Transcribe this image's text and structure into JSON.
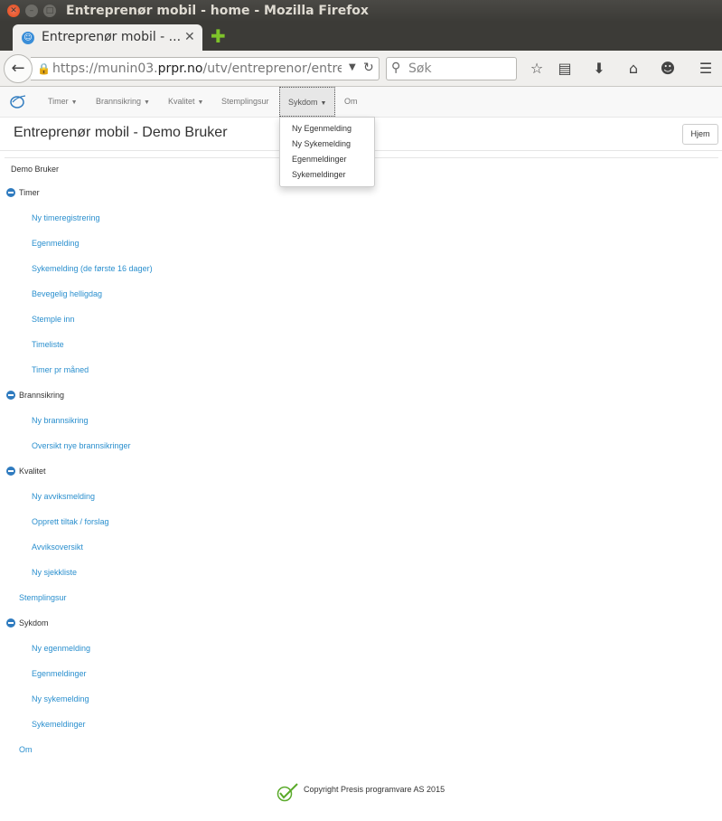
{
  "window": {
    "title": "Entreprenør mobil - home - Mozilla Firefox",
    "close_glyph": "✕",
    "min_glyph": "–",
    "max_glyph": "□"
  },
  "browser": {
    "tab_title": "Entreprenør mobil - ...",
    "tab_close": "✕",
    "new_tab": "✚",
    "url_prefix": "https://munin03.",
    "url_domain": "prpr.no",
    "url_suffix": "/utv/entreprenor/entrep",
    "search_placeholder": "Søk",
    "icons": [
      "bookmark-star-icon",
      "reading-list-icon",
      "download-icon",
      "home-icon",
      "smiley-icon",
      "menu-icon"
    ]
  },
  "nav": {
    "items": [
      "Timer",
      "Brannsikring",
      "Kvalitet",
      "Stemplingsur",
      "Sykdom",
      "Om"
    ],
    "active": "Sykdom"
  },
  "dropdown": [
    "Ny Egenmelding",
    "Ny Sykemelding",
    "Egenmeldinger",
    "Sykemeldinger"
  ],
  "page": {
    "title": "Entreprenør mobil - Demo Bruker",
    "home_button": "Hjem",
    "user": "Demo Bruker"
  },
  "menu": {
    "timer": {
      "label": "Timer",
      "items": [
        "Ny timeregistrering",
        "Egenmelding",
        "Sykemelding (de første 16 dager)",
        "Bevegelig helligdag",
        "Stemple inn",
        "Timeliste",
        "Timer pr måned"
      ]
    },
    "brannsikring": {
      "label": "Brannsikring",
      "items": [
        "Ny brannsikring",
        "Oversikt nye brannsikringer"
      ]
    },
    "kvalitet": {
      "label": "Kvalitet",
      "items": [
        "Ny avviksmelding",
        "Opprett tiltak / forslag",
        "Avviksoversikt",
        "Ny sjekkliste"
      ]
    },
    "stemplingsur": "Stemplingsur",
    "sykdom": {
      "label": "Sykdom",
      "items": [
        "Ny egenmelding",
        "Egenmeldinger",
        "Ny sykemelding",
        "Sykemeldinger"
      ]
    },
    "om": "Om"
  },
  "footer": {
    "text": "Copyright Presis programvare AS 2015"
  },
  "colors": {
    "link": "#2a8fce",
    "accent_blue": "#2f7bbf",
    "logo_green": "#5aaa2a"
  }
}
